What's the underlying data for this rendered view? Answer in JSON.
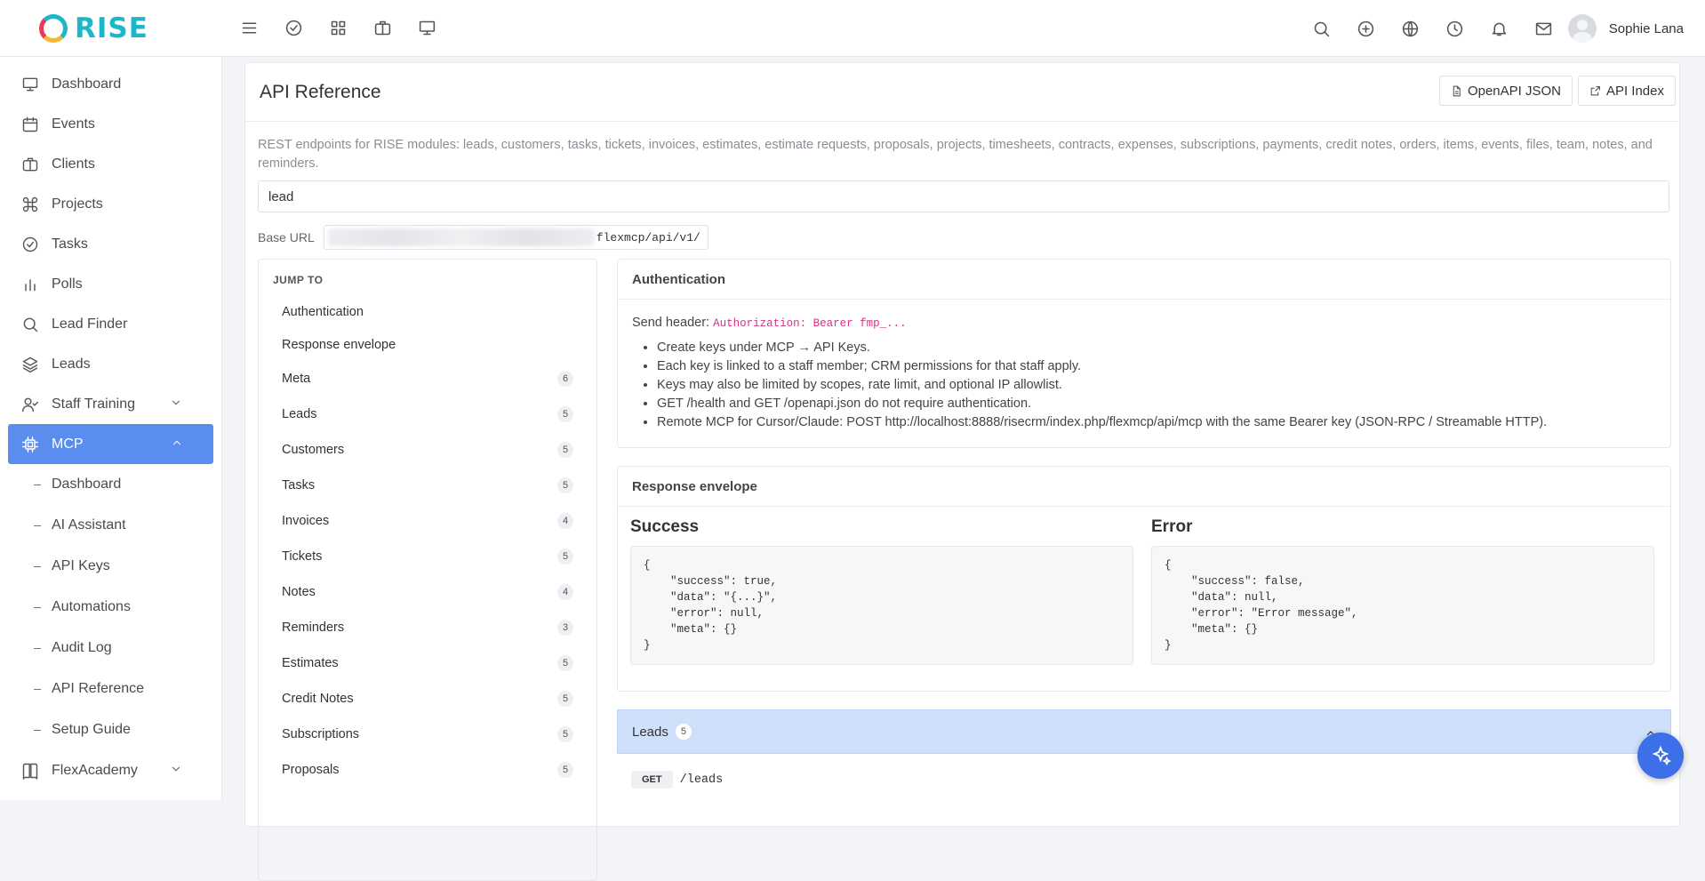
{
  "app": {
    "logo_text": "RISE",
    "brand_color": "#1fb6c8",
    "accent": "#5b8def"
  },
  "topbar": {
    "left_icons": [
      "menu-icon",
      "check-circle-icon",
      "grid-icon",
      "briefcase-icon",
      "monitor-icon"
    ],
    "right_icons": [
      "search-icon",
      "plus-circle-icon",
      "globe-icon",
      "clock-icon",
      "bell-icon",
      "mail-icon"
    ],
    "user_name": "Sophie Lana"
  },
  "sidebar": {
    "items": [
      {
        "label": "Dashboard",
        "icon": "monitor-icon"
      },
      {
        "label": "Events",
        "icon": "calendar-icon"
      },
      {
        "label": "Clients",
        "icon": "briefcase-icon"
      },
      {
        "label": "Projects",
        "icon": "command-icon"
      },
      {
        "label": "Tasks",
        "icon": "check-circle-icon"
      },
      {
        "label": "Polls",
        "icon": "bar-chart-icon"
      },
      {
        "label": "Lead Finder",
        "icon": "search-icon"
      },
      {
        "label": "Leads",
        "icon": "layers-icon"
      },
      {
        "label": "Staff Training",
        "icon": "user-check-icon"
      },
      {
        "label": "MCP",
        "icon": "cpu-icon"
      }
    ],
    "mcp_sub": [
      "Dashboard",
      "AI Assistant",
      "API Keys",
      "Automations",
      "Audit Log",
      "API Reference",
      "Setup Guide"
    ],
    "bottom_item": {
      "label": "FlexAcademy",
      "icon": "book-icon"
    }
  },
  "page": {
    "title": "API Reference",
    "btn_openapi": "OpenAPI JSON",
    "btn_index": "API Index",
    "description": "REST endpoints for RISE modules: leads, customers, tasks, tickets, invoices, estimates, estimate requests, proposals, projects, timesheets, contracts, expenses, subscriptions, payments, credit notes, orders, items, events, files, team, notes, and reminders.",
    "search_value": "lead",
    "base_label": "Base URL",
    "base_url_suffix": "flexmcp/api/v1/"
  },
  "jump": {
    "title": "JUMP TO",
    "items": [
      {
        "label": "Authentication",
        "count": ""
      },
      {
        "label": "Response envelope",
        "count": ""
      },
      {
        "label": "Meta",
        "count": "6"
      },
      {
        "label": "Leads",
        "count": "5"
      },
      {
        "label": "Customers",
        "count": "5"
      },
      {
        "label": "Tasks",
        "count": "5"
      },
      {
        "label": "Invoices",
        "count": "4"
      },
      {
        "label": "Tickets",
        "count": "5"
      },
      {
        "label": "Notes",
        "count": "4"
      },
      {
        "label": "Reminders",
        "count": "3"
      },
      {
        "label": "Estimates",
        "count": "5"
      },
      {
        "label": "Credit Notes",
        "count": "5"
      },
      {
        "label": "Subscriptions",
        "count": "5"
      },
      {
        "label": "Proposals",
        "count": "5"
      }
    ]
  },
  "auth": {
    "title": "Authentication",
    "send_header_label": "Send header:",
    "header_code": "Authorization: Bearer fmp_...",
    "bullets": [
      "Create keys under MCP → API Keys.",
      "Each key is linked to a staff member; CRM permissions for that staff apply.",
      "Keys may also be limited by scopes, rate limit, and optional IP allowlist.",
      "GET /health and GET /openapi.json do not require authentication.",
      "Remote MCP for Cursor/Claude: POST http://localhost:8888/risecrm/index.php/flexmcp/api/mcp with the same Bearer key (JSON-RPC / Streamable HTTP)."
    ]
  },
  "envelope": {
    "title": "Response envelope",
    "success_title": "Success",
    "success_code": "{\n    \"success\": true,\n    \"data\": \"{...}\",\n    \"error\": null,\n    \"meta\": {}\n}",
    "error_title": "Error",
    "error_code": "{\n    \"success\": false,\n    \"data\": null,\n    \"error\": \"Error message\",\n    \"meta\": {}\n}"
  },
  "leads_section": {
    "title": "Leads",
    "count": "5",
    "method": "GET",
    "path": "/leads"
  }
}
